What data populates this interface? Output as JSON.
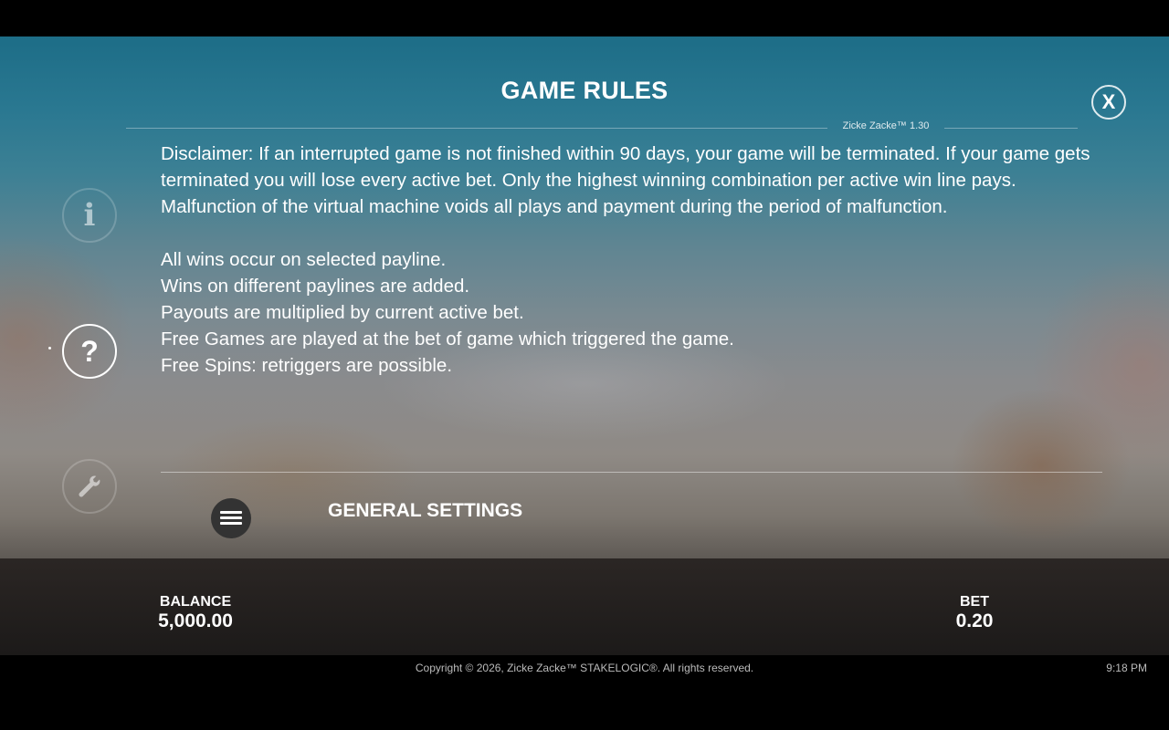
{
  "header": {
    "title": "GAME RULES",
    "version": "Zicke Zacke™ 1.30",
    "close_label": "X"
  },
  "sidebar": {
    "items": [
      {
        "name": "info",
        "glyph": "i"
      },
      {
        "name": "help",
        "glyph": "?"
      },
      {
        "name": "settings",
        "icon": "wrench-icon"
      }
    ]
  },
  "rules": {
    "disclaimer": "Disclaimer: If an interrupted game is not finished within 90 days, your game will be terminated. If your game gets terminated you will lose every active bet. Only the highest winning combination per active win line pays. Malfunction of the virtual machine voids all plays and payment during the period of malfunction.",
    "lines": [
      "All wins occur on selected payline.",
      "Wins on different paylines are added.",
      "Payouts are multiplied by current active bet.",
      "Free Games are played at the bet of game which triggered the game.",
      "Free Spins: retriggers are possible."
    ]
  },
  "section": {
    "general_settings": "GENERAL SETTINGS"
  },
  "bottom": {
    "balance_label": "BALANCE",
    "balance_value": "5,000.00",
    "bet_label": "BET",
    "bet_value": "0.20"
  },
  "footer": {
    "copyright": "Copyright © 2026, Zicke Zacke™ STAKELOGIC®. All rights reserved.",
    "clock": "9:18 PM"
  }
}
